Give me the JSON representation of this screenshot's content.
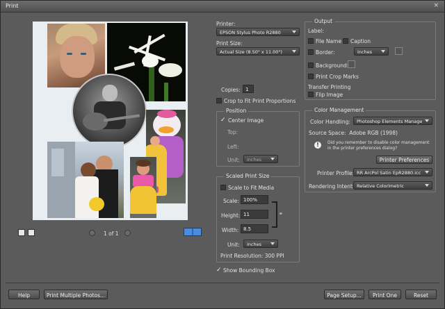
{
  "window": {
    "title": "Print",
    "close": "×"
  },
  "preview": {
    "pager": "1 of 1"
  },
  "printer": {
    "label": "Printer:",
    "value": "EPSON Stylus Photo R2880"
  },
  "print_size": {
    "label": "Print Size:",
    "value": "Actual Size (8.50\" x 11.00\")"
  },
  "copies": {
    "label": "Copies:",
    "value": "1"
  },
  "crop_to_fit": {
    "label": "Crop to Fit Print Proportions",
    "checked": false
  },
  "position": {
    "title": "Position",
    "center_image": {
      "label": "Center Image",
      "checked": true
    },
    "top_label": "Top:",
    "left_label": "Left:",
    "unit_label": "Unit:",
    "unit_value": "inches"
  },
  "scaled": {
    "title": "Scaled Print Size",
    "scale_to_fit": {
      "label": "Scale to Fit Media",
      "checked": false
    },
    "scale_label": "Scale:",
    "scale_value": "100%",
    "height_label": "Height:",
    "height_value": "11",
    "width_label": "Width:",
    "width_value": "8.5",
    "unit_label": "Unit:",
    "unit_value": "inches",
    "resolution": "Print Resolution: 300 PPI"
  },
  "show_bounding_box": {
    "label": "Show Bounding Box",
    "checked": true
  },
  "output": {
    "title": "Output",
    "label_heading": "Label:",
    "file_name": {
      "label": "File Name",
      "checked": false
    },
    "caption": {
      "label": "Caption",
      "checked": false
    },
    "border": {
      "label": "Border:",
      "checked": false,
      "unit": "inches"
    },
    "background": {
      "label": "Background:",
      "checked": false
    },
    "crop_marks": {
      "label": "Print Crop Marks",
      "checked": false
    },
    "transfer_heading": "Transfer Printing",
    "flip_image": {
      "label": "Flip Image",
      "checked": false
    }
  },
  "color": {
    "title": "Color Management",
    "handling_label": "Color Handling:",
    "handling_value": "Photoshop Elements Manages Co",
    "source_space": "Source Space:  Adobe RGB (1998)",
    "info_text": "Did you remember to disable color management in the printer preferences dialog?",
    "prefs_button": "Printer Preferences",
    "profile_label": "Printer Profile:",
    "profile_value": "RR ArcPol Satin EpR2880.icc",
    "intent_label": "Rendering Intent:",
    "intent_value": "Relative Colorimetric"
  },
  "buttons": {
    "help": "Help",
    "multiple": "Print Multiple Photos...",
    "page_setup": "Page Setup...",
    "print_one": "Print One",
    "reset": "Reset"
  },
  "colors": {
    "dialog_bg": "#5b5b5b",
    "panel_border": "#7a7a7a",
    "preview_bg": "#e9eef2"
  }
}
